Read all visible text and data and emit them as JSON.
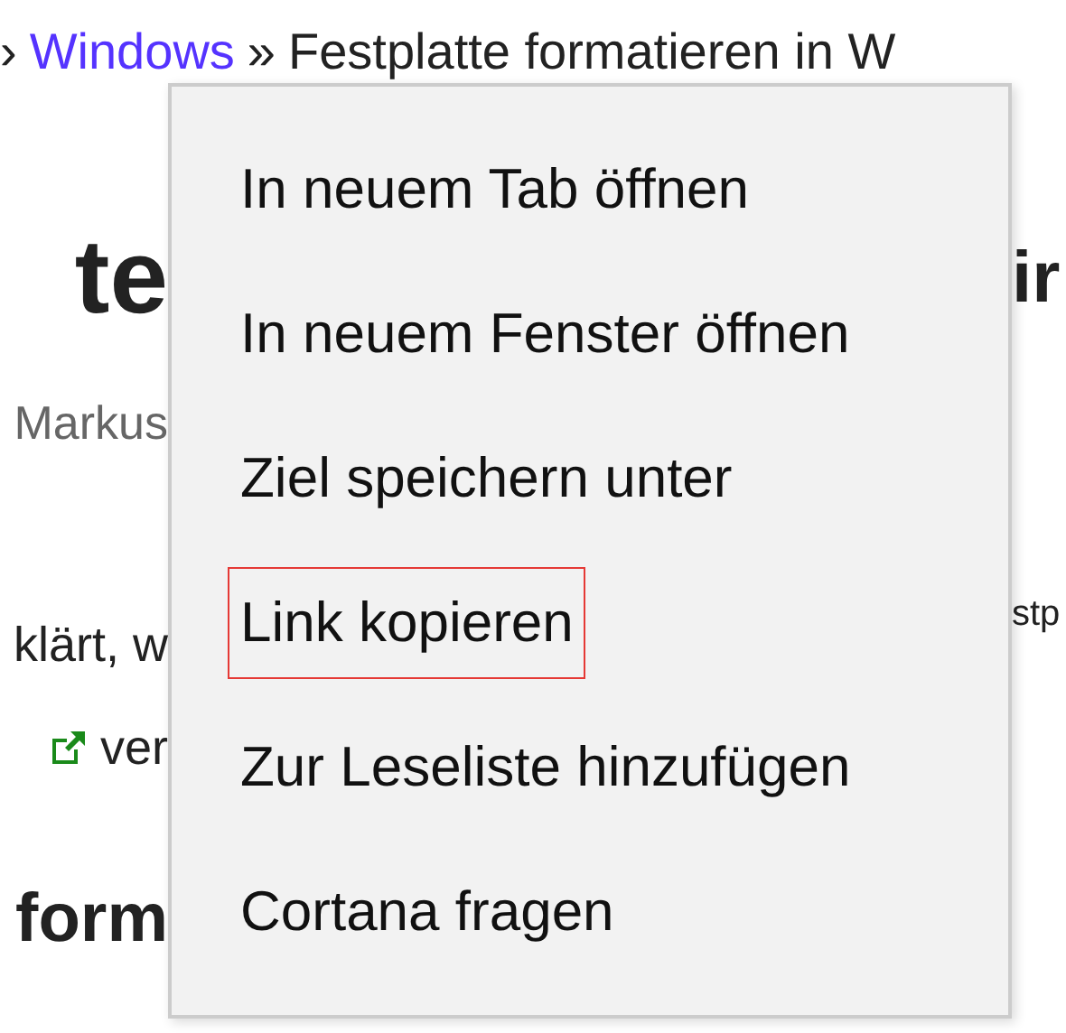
{
  "breadcrumb": [
    {
      "kind": "separator",
      "text": "›"
    },
    {
      "kind": "link",
      "text": "Windows"
    },
    {
      "kind": "separator",
      "text": "»"
    },
    {
      "kind": "text",
      "text": "Festplatte formatieren in W"
    }
  ],
  "page_left": {
    "headline": "te",
    "author": "Markus",
    "paragraph": "klärt, w",
    "link_line": "ver",
    "heading": "form"
  },
  "page_right": {
    "headline": "ir",
    "paragraph": "stp"
  },
  "context_menu": {
    "items": [
      {
        "label": "In neuem Tab öffnen",
        "focused": false
      },
      {
        "label": "In neuem Fenster öffnen",
        "focused": false
      },
      {
        "label": "Ziel speichern unter",
        "focused": false
      },
      {
        "label": "Link kopieren",
        "focused": true
      },
      {
        "label": "Zur Leseliste hinzufügen",
        "focused": false
      },
      {
        "label": "Cortana fragen",
        "focused": false
      }
    ]
  }
}
